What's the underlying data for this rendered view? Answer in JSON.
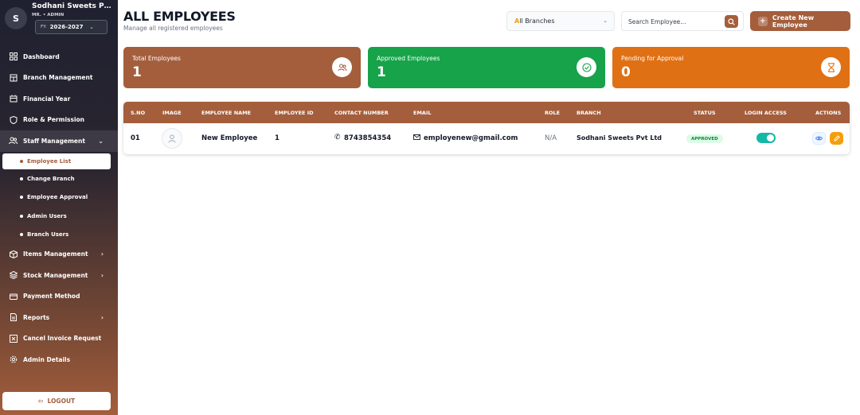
{
  "sidebar": {
    "avatar_letter": "S",
    "org_name": "Sodhani Sweets Pvt Ltd",
    "role": "MR. • ADMIN",
    "fy_label": "FY:",
    "fy_value": "2026-2027",
    "items": [
      {
        "label": "Dashboard",
        "icon": "dashboard-icon"
      },
      {
        "label": "Branch Management",
        "icon": "building-icon"
      },
      {
        "label": "Financial Year",
        "icon": "calendar-icon"
      },
      {
        "label": "Role & Permission",
        "icon": "shield-icon"
      },
      {
        "label": "Staff Management",
        "icon": "users-icon",
        "expanded": true
      },
      {
        "label": "Items Management",
        "icon": "box-icon"
      },
      {
        "label": "Stock Management",
        "icon": "layers-icon"
      },
      {
        "label": "Payment Method",
        "icon": "card-icon"
      },
      {
        "label": "Reports",
        "icon": "report-icon"
      },
      {
        "label": "Cancel Invoice Request",
        "icon": "cancel-icon"
      },
      {
        "label": "Admin Details",
        "icon": "settings-icon"
      }
    ],
    "staff_submenu": [
      "Employee List",
      "Change Branch",
      "Employee Approval",
      "Admin Users",
      "Branch Users"
    ],
    "logout_label": "LOGOUT"
  },
  "header": {
    "title": "ALL EMPLOYEES",
    "subtitle": "Manage all registered employees",
    "branch_select_prefix": "A",
    "branch_select_rest": "ll Branches",
    "search_placeholder": "Search Employee...",
    "create_label": "Create New Employee"
  },
  "stats": [
    {
      "label": "Total Employees",
      "value": "1",
      "color": "#a45e3c"
    },
    {
      "label": "Approved Employees",
      "value": "1",
      "color": "#16a34a"
    },
    {
      "label": "Pending for Approval",
      "value": "0",
      "color": "#e07014"
    }
  ],
  "table": {
    "columns": [
      "S.NO",
      "IMAGE",
      "EMPLOYEE NAME",
      "EMPLOYEE ID",
      "CONTACT NUMBER",
      "EMAIL",
      "ROLE",
      "BRANCH",
      "STATUS",
      "LOGIN ACCESS",
      "ACTIONS"
    ],
    "rows": [
      {
        "sno": "01",
        "name": "New Employee",
        "id": "1",
        "contact": "8743854354",
        "email": "employenew@gmail.com",
        "role": "N/A",
        "branch": "Sodhani Sweets Pvt Ltd",
        "status": "APPROVED",
        "login_access": true
      }
    ]
  },
  "colors": {
    "brand": "#a45e3c",
    "success": "#16a34a",
    "warning": "#e07014",
    "teal": "#14b8a6"
  }
}
